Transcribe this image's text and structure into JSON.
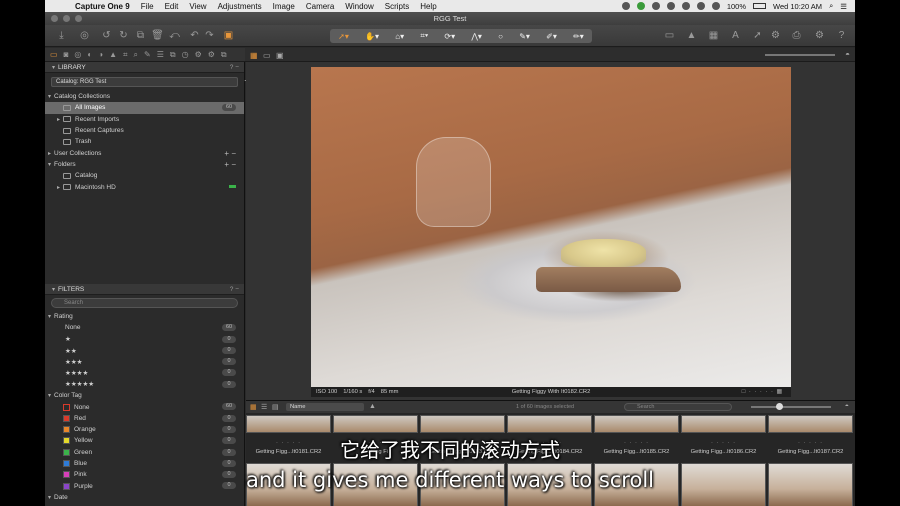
{
  "menubar": {
    "app": "Capture One 9",
    "items": [
      "File",
      "Edit",
      "View",
      "Adjustments",
      "Image",
      "Camera",
      "Window",
      "Scripts",
      "Help"
    ],
    "battery": "100%",
    "clock": "Wed 10:20 AM"
  },
  "window": {
    "title": "RGG Test"
  },
  "library": {
    "title": "LIBRARY",
    "catalog_select": "Catalog: RGG Test",
    "catalog_collections": "Catalog Collections",
    "all_images": "All Images",
    "all_images_count": "60",
    "recent_imports": "Recent Imports",
    "recent_captures": "Recent Captures",
    "trash": "Trash",
    "user_collections": "User Collections",
    "folders": "Folders",
    "folder_catalog": "Catalog",
    "folder_macintosh": "Macintosh HD"
  },
  "filters": {
    "title": "FILTERS",
    "search_placeholder": "Search",
    "rating_header": "Rating",
    "ratings": [
      {
        "label": "None",
        "count": "60"
      },
      {
        "label": "★",
        "count": "0"
      },
      {
        "label": "★★",
        "count": "0"
      },
      {
        "label": "★★★",
        "count": "0"
      },
      {
        "label": "★★★★",
        "count": "0"
      },
      {
        "label": "★★★★★",
        "count": "0"
      }
    ],
    "color_tag_header": "Color Tag",
    "color_tags": [
      {
        "label": "None",
        "count": "60",
        "color": "#2b2b2b"
      },
      {
        "label": "Red",
        "count": "0",
        "color": "#d93a2b"
      },
      {
        "label": "Orange",
        "count": "0",
        "color": "#e8862a"
      },
      {
        "label": "Yellow",
        "count": "0",
        "color": "#e4d82b"
      },
      {
        "label": "Green",
        "count": "0",
        "color": "#3bb34a"
      },
      {
        "label": "Blue",
        "count": "0",
        "color": "#2e7bd6"
      },
      {
        "label": "Pink",
        "count": "0",
        "color": "#d63fb9"
      },
      {
        "label": "Purple",
        "count": "0",
        "color": "#8a45c8"
      }
    ],
    "date_header": "Date"
  },
  "viewer": {
    "iso": "ISO 100",
    "shutter": "1/160 s",
    "aperture": "f/4",
    "focal": "85 mm",
    "filename": "Getting Figgy With It0182.CR2"
  },
  "browser": {
    "sort": "Name",
    "selection_count": "1 of 60 images selected",
    "search_placeholder": "Search",
    "thumb_labels": [
      "Getting Figg...It0181.CR2",
      "Getting Fi",
      "Getting Figg...It0183.CR2",
      "Getting Figg...It0184.CR2",
      "Getting Figg...It0185.CR2",
      "Getting Figg...It0186.CR2",
      "Getting Figg...It0187.CR2"
    ]
  },
  "subtitles": {
    "chinese": "它给了我不同的滚动方式",
    "english": "and it gives me different ways to scroll"
  }
}
